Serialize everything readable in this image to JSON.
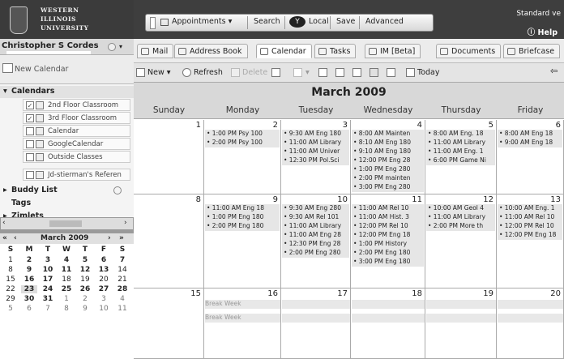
{
  "university": {
    "line1": "WESTERN",
    "line2": "ILLINOIS",
    "line3": "UNIVERSITY"
  },
  "topbar": {
    "appointments": "Appointments",
    "search": "Search",
    "local": "Local",
    "save": "Save",
    "advanced": "Advanced",
    "standard_view": "Standard ve",
    "help": "Help"
  },
  "user": {
    "name": "Christopher S Cordes"
  },
  "tabs": [
    "Mail",
    "Address Book",
    "Calendar",
    "Tasks",
    "IM [Beta]",
    "Documents",
    "Briefcase"
  ],
  "toolbar": {
    "new": "New",
    "refresh": "Refresh",
    "delete": "Delete",
    "today": "Today"
  },
  "sidebar": {
    "new_calendar": "New Calendar",
    "calendars_header": "Calendars",
    "calendars": [
      {
        "label": "2nd Floor Classroom",
        "checked": "✓"
      },
      {
        "label": "3rd Floor Classroom",
        "checked": "✓"
      },
      {
        "label": "Calendar",
        "checked": ""
      },
      {
        "label": "GoogleCalendar",
        "checked": ""
      },
      {
        "label": "Outside Classes",
        "checked": ""
      },
      {
        "label": "Jd-stierman's Referen",
        "checked": ""
      }
    ],
    "buddy_list": "Buddy List",
    "tags": "Tags",
    "zimlets": "Zimlets"
  },
  "mini_cal": {
    "title": "March 2009",
    "nav_prev2": "«",
    "nav_prev": "‹",
    "nav_next": "›",
    "nav_next2": "»",
    "days": [
      "S",
      "M",
      "T",
      "W",
      "T",
      "F",
      "S"
    ],
    "weeks": [
      [
        "1",
        "2",
        "3",
        "4",
        "5",
        "6",
        "7"
      ],
      [
        "8",
        "9",
        "10",
        "11",
        "12",
        "13",
        "14"
      ],
      [
        "15",
        "16",
        "17",
        "18",
        "19",
        "20",
        "21"
      ],
      [
        "22",
        "23",
        "24",
        "25",
        "26",
        "27",
        "28"
      ],
      [
        "29",
        "30",
        "31",
        "1",
        "2",
        "3",
        "4"
      ],
      [
        "5",
        "6",
        "7",
        "8",
        "9",
        "10",
        "11"
      ]
    ]
  },
  "calendar": {
    "title": "March 2009",
    "weekdays": [
      "Sunday",
      "Monday",
      "Tuesday",
      "Wednesday",
      "Thursday",
      "Friday"
    ],
    "weeks": [
      [
        {
          "day": "1",
          "events": []
        },
        {
          "day": "2",
          "events": [
            "• 1:00 PM Psy 100",
            "• 2:00 PM Psy 100"
          ]
        },
        {
          "day": "3",
          "events": [
            "• 9:30 AM Eng 180",
            "• 11:00 AM Library",
            "• 11:00 AM Univer",
            "• 12:30 PM Pol.Sci"
          ]
        },
        {
          "day": "4",
          "events": [
            "• 8:00 AM Mainten",
            "• 8:10 AM Eng 180",
            "• 9:10 AM Eng 180",
            "• 12:00 PM Eng 28",
            "• 1:00 PM Eng 280",
            "• 2:00 PM mainten",
            "• 3:00 PM Eng 280"
          ]
        },
        {
          "day": "5",
          "events": [
            "• 8:00 AM Eng. 18",
            "• 11:00 AM Library",
            "• 11:00 AM Eng. 1",
            "• 6:00 PM Game Ni"
          ]
        },
        {
          "day": "6",
          "events": [
            "• 8:00 AM Eng 18",
            "• 9:00 AM Eng 18"
          ]
        }
      ],
      [
        {
          "day": "8",
          "events": []
        },
        {
          "day": "9",
          "events": [
            "• 11:00 AM Eng 18",
            "• 1:00 PM Eng 180",
            "• 2:00 PM Eng 180"
          ]
        },
        {
          "day": "10",
          "events": [
            "• 9:30 AM Eng 280",
            "• 9:30 AM Rel 101",
            "• 11:00 AM Library",
            "• 11:00 AM Eng 28",
            "• 12:30 PM Eng 28",
            "• 2:00 PM Eng 280"
          ]
        },
        {
          "day": "11",
          "events": [
            "• 11:00 AM Rel 10",
            "• 11:00 AM Hist. 3",
            "• 12:00 PM Rel 10",
            "• 12:00 PM Eng 18",
            "• 1:00 PM History",
            "• 2:00 PM Eng 180",
            "• 3:00 PM Eng 180"
          ]
        },
        {
          "day": "12",
          "events": [
            "• 10:00 AM Geol 4",
            "• 11:00 AM Library",
            "• 2:00 PM More th"
          ]
        },
        {
          "day": "13",
          "events": [
            "• 10:00 AM Eng. 1",
            "• 11:00 AM Rel 10",
            "• 12:00 PM Rel 10",
            "• 12:00 PM Eng 18"
          ]
        }
      ],
      [
        {
          "day": "15",
          "events": []
        },
        {
          "day": "16",
          "events": []
        },
        {
          "day": "17",
          "events": []
        },
        {
          "day": "18",
          "events": []
        },
        {
          "day": "19",
          "events": []
        },
        {
          "day": "20",
          "events": []
        }
      ]
    ],
    "break_week": "Break Week"
  }
}
